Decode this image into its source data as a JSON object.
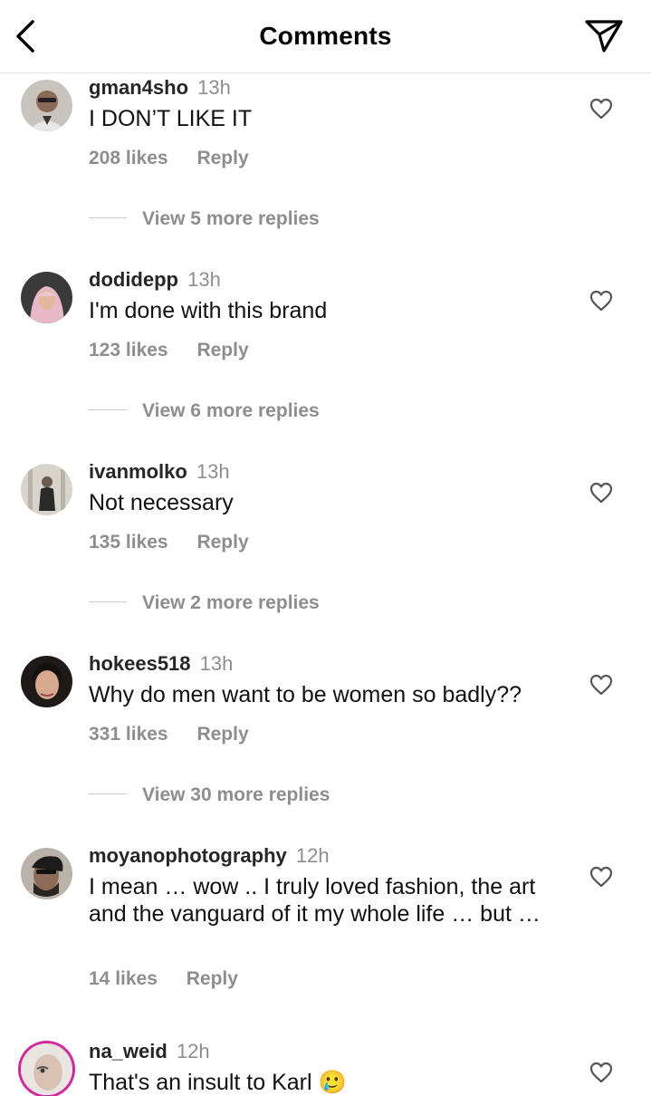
{
  "header": {
    "title": "Comments",
    "back_icon": "chevron-left-icon",
    "share_icon": "send-icon"
  },
  "comments": [
    {
      "username": "gman4sho",
      "time": "13h",
      "text": "I DON’T LIKE IT",
      "likes": "208 likes",
      "reply": "Reply",
      "view_replies": "View 5 more replies"
    },
    {
      "username": "dodidepp",
      "time": "13h",
      "text": "I'm done with this brand",
      "likes": "123 likes",
      "reply": "Reply",
      "view_replies": "View 6 more replies"
    },
    {
      "username": "ivanmolko",
      "time": "13h",
      "text": "Not necessary",
      "likes": "135 likes",
      "reply": "Reply",
      "view_replies": "View 2 more replies"
    },
    {
      "username": "hokees518",
      "time": "13h",
      "text": "Why do men want to be women so badly??",
      "likes": "331 likes",
      "reply": "Reply",
      "view_replies": "View 30 more replies"
    },
    {
      "username": "moyanophotography",
      "time": "12h",
      "text": "I mean … wow .. I truly loved fashion, the art and the vanguard of it my whole life … but …",
      "likes": "14 likes",
      "reply": "Reply"
    },
    {
      "username": "na_weid",
      "time": "12h",
      "text": "That's an insult to Karl 🥲"
    }
  ],
  "colors": {
    "muted": "#8e8e8e",
    "story_ring": "#d6249f",
    "divider": "#e6e6e6"
  }
}
